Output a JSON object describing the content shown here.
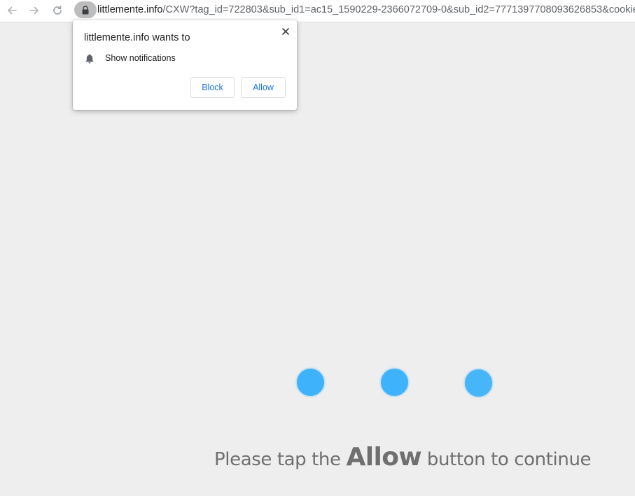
{
  "browser": {
    "back_icon": "arrow-left-icon",
    "forward_icon": "arrow-right-icon",
    "reload_icon": "reload-icon",
    "lock_icon": "lock-icon",
    "url_host": "littlemente.info",
    "url_path": "/CXW?tag_id=722803&sub_id1=ac15_1590229-2366072709-0&sub_id2=7771397708093626853&cookie_i"
  },
  "permission_popup": {
    "title": "littlemente.info wants to",
    "close_icon": "close-icon",
    "permission_icon": "bell-icon",
    "permission_label": "Show notifications",
    "block_label": "Block",
    "allow_label": "Allow"
  },
  "page": {
    "dot_color": "#3eb3fb",
    "message_before": "Please tap the ",
    "message_emphasis": "Allow",
    "message_after": " button to continue"
  }
}
